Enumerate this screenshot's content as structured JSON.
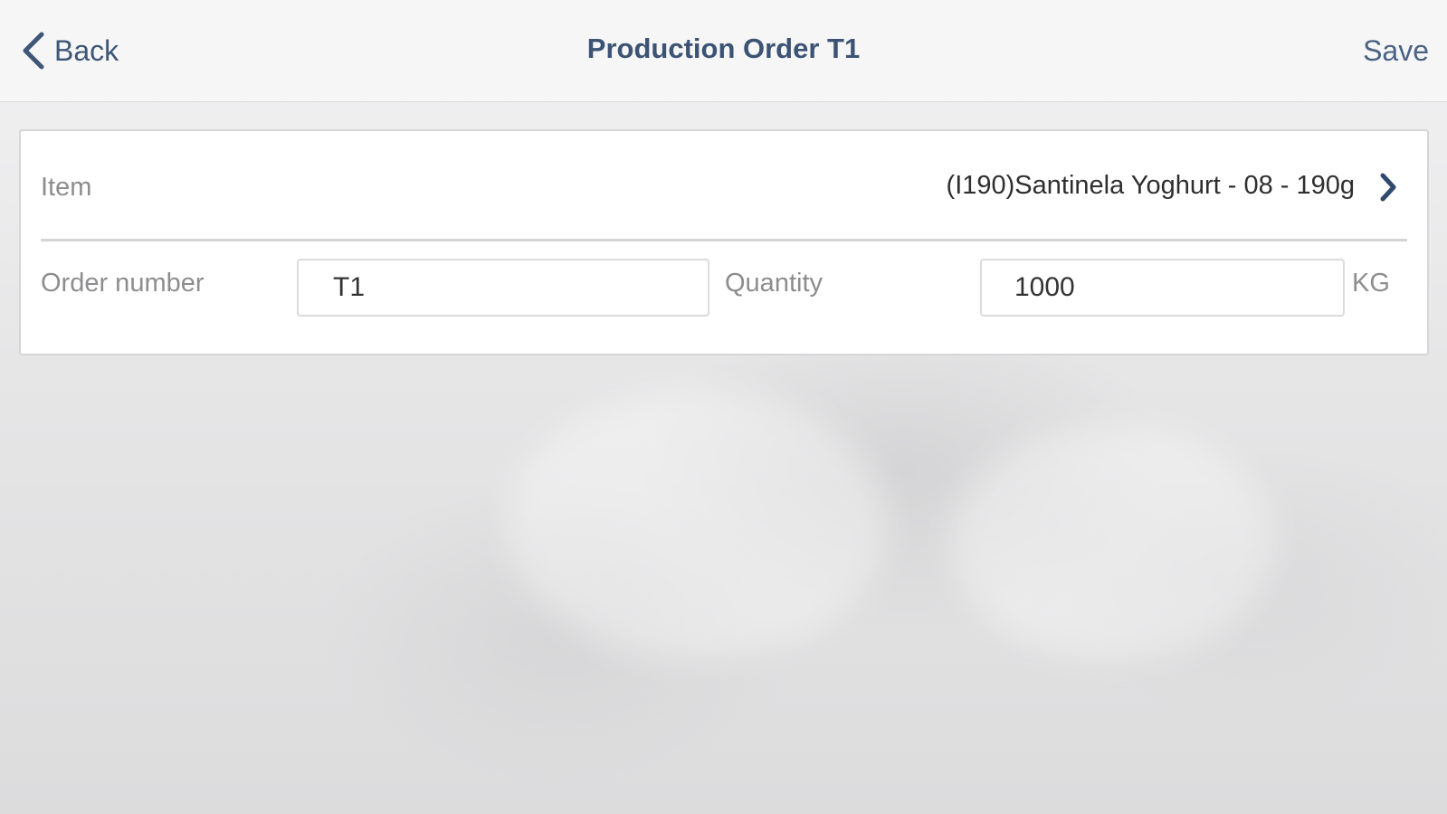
{
  "nav": {
    "back_label": "Back",
    "title": "Production Order T1",
    "save_label": "Save"
  },
  "form": {
    "item": {
      "label": "Item",
      "value": "(I190)Santinela Yoghurt - 08 - 190g"
    },
    "order_number": {
      "label": "Order number",
      "value": "T1"
    },
    "quantity": {
      "label": "Quantity",
      "value": "1000",
      "unit": "KG"
    }
  },
  "icons": {
    "back": "chevron-left-icon",
    "item_disclosure": "chevron-right-icon"
  },
  "colors": {
    "accent": "#3e5677",
    "label": "#8d8d90",
    "value": "#2f2f31"
  }
}
